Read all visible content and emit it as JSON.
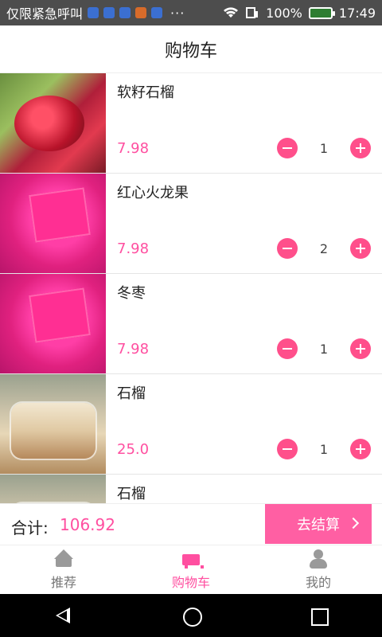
{
  "status_bar": {
    "left_text": "仅限紧急呼叫",
    "dots": "···",
    "battery_percent": "100%",
    "time": "17:49",
    "icons": [
      "sim-icon",
      "usb-icon",
      "mail-icon",
      "app-icon",
      "shield-icon",
      "wifi-icon",
      "signal-icon",
      "battery-icon"
    ]
  },
  "header": {
    "title": "购物车"
  },
  "items": [
    {
      "name": "软籽石榴",
      "price": "7.98",
      "qty": "1",
      "thumb": "pomegranate"
    },
    {
      "name": "红心火龙果",
      "price": "7.98",
      "qty": "2",
      "thumb": "pitaya"
    },
    {
      "name": "冬枣",
      "price": "7.98",
      "qty": "1",
      "thumb": "pitaya"
    },
    {
      "name": "石榴",
      "price": "25.0",
      "qty": "1",
      "thumb": "pudding"
    },
    {
      "name": "石榴",
      "price": "",
      "qty": "",
      "thumb": "pudding"
    }
  ],
  "checkout": {
    "total_label": "合计:",
    "total_value": "106.92",
    "button_label": "去结算"
  },
  "tabs": [
    {
      "label": "推荐",
      "icon": "home-icon",
      "active": false
    },
    {
      "label": "购物车",
      "icon": "cart-icon",
      "active": true
    },
    {
      "label": "我的",
      "icon": "user-icon",
      "active": false
    }
  ],
  "colors": {
    "accent": "#ff4fa0",
    "button": "#ff5fa3",
    "qty_button": "#ff4f8b",
    "status_bar": "#4d4d4d"
  }
}
